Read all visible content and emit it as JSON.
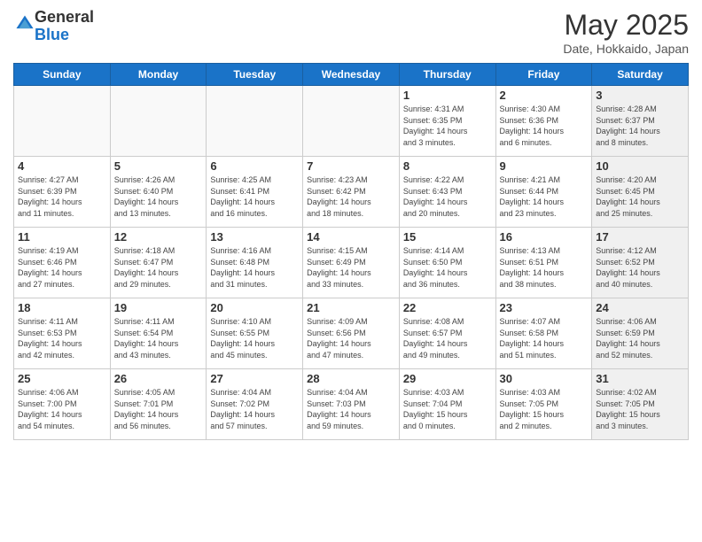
{
  "logo": {
    "general": "General",
    "blue": "Blue"
  },
  "title": "May 2025",
  "subtitle": "Date, Hokkaido, Japan",
  "days_of_week": [
    "Sunday",
    "Monday",
    "Tuesday",
    "Wednesday",
    "Thursday",
    "Friday",
    "Saturday"
  ],
  "weeks": [
    [
      {
        "day": "",
        "info": "",
        "empty": true
      },
      {
        "day": "",
        "info": "",
        "empty": true
      },
      {
        "day": "",
        "info": "",
        "empty": true
      },
      {
        "day": "",
        "info": "",
        "empty": true
      },
      {
        "day": "1",
        "info": "Sunrise: 4:31 AM\nSunset: 6:35 PM\nDaylight: 14 hours\nand 3 minutes."
      },
      {
        "day": "2",
        "info": "Sunrise: 4:30 AM\nSunset: 6:36 PM\nDaylight: 14 hours\nand 6 minutes."
      },
      {
        "day": "3",
        "info": "Sunrise: 4:28 AM\nSunset: 6:37 PM\nDaylight: 14 hours\nand 8 minutes.",
        "shaded": true
      }
    ],
    [
      {
        "day": "4",
        "info": "Sunrise: 4:27 AM\nSunset: 6:39 PM\nDaylight: 14 hours\nand 11 minutes."
      },
      {
        "day": "5",
        "info": "Sunrise: 4:26 AM\nSunset: 6:40 PM\nDaylight: 14 hours\nand 13 minutes."
      },
      {
        "day": "6",
        "info": "Sunrise: 4:25 AM\nSunset: 6:41 PM\nDaylight: 14 hours\nand 16 minutes."
      },
      {
        "day": "7",
        "info": "Sunrise: 4:23 AM\nSunset: 6:42 PM\nDaylight: 14 hours\nand 18 minutes."
      },
      {
        "day": "8",
        "info": "Sunrise: 4:22 AM\nSunset: 6:43 PM\nDaylight: 14 hours\nand 20 minutes."
      },
      {
        "day": "9",
        "info": "Sunrise: 4:21 AM\nSunset: 6:44 PM\nDaylight: 14 hours\nand 23 minutes."
      },
      {
        "day": "10",
        "info": "Sunrise: 4:20 AM\nSunset: 6:45 PM\nDaylight: 14 hours\nand 25 minutes.",
        "shaded": true
      }
    ],
    [
      {
        "day": "11",
        "info": "Sunrise: 4:19 AM\nSunset: 6:46 PM\nDaylight: 14 hours\nand 27 minutes."
      },
      {
        "day": "12",
        "info": "Sunrise: 4:18 AM\nSunset: 6:47 PM\nDaylight: 14 hours\nand 29 minutes."
      },
      {
        "day": "13",
        "info": "Sunrise: 4:16 AM\nSunset: 6:48 PM\nDaylight: 14 hours\nand 31 minutes."
      },
      {
        "day": "14",
        "info": "Sunrise: 4:15 AM\nSunset: 6:49 PM\nDaylight: 14 hours\nand 33 minutes."
      },
      {
        "day": "15",
        "info": "Sunrise: 4:14 AM\nSunset: 6:50 PM\nDaylight: 14 hours\nand 36 minutes."
      },
      {
        "day": "16",
        "info": "Sunrise: 4:13 AM\nSunset: 6:51 PM\nDaylight: 14 hours\nand 38 minutes."
      },
      {
        "day": "17",
        "info": "Sunrise: 4:12 AM\nSunset: 6:52 PM\nDaylight: 14 hours\nand 40 minutes.",
        "shaded": true
      }
    ],
    [
      {
        "day": "18",
        "info": "Sunrise: 4:11 AM\nSunset: 6:53 PM\nDaylight: 14 hours\nand 42 minutes."
      },
      {
        "day": "19",
        "info": "Sunrise: 4:11 AM\nSunset: 6:54 PM\nDaylight: 14 hours\nand 43 minutes."
      },
      {
        "day": "20",
        "info": "Sunrise: 4:10 AM\nSunset: 6:55 PM\nDaylight: 14 hours\nand 45 minutes."
      },
      {
        "day": "21",
        "info": "Sunrise: 4:09 AM\nSunset: 6:56 PM\nDaylight: 14 hours\nand 47 minutes."
      },
      {
        "day": "22",
        "info": "Sunrise: 4:08 AM\nSunset: 6:57 PM\nDaylight: 14 hours\nand 49 minutes."
      },
      {
        "day": "23",
        "info": "Sunrise: 4:07 AM\nSunset: 6:58 PM\nDaylight: 14 hours\nand 51 minutes."
      },
      {
        "day": "24",
        "info": "Sunrise: 4:06 AM\nSunset: 6:59 PM\nDaylight: 14 hours\nand 52 minutes.",
        "shaded": true
      }
    ],
    [
      {
        "day": "25",
        "info": "Sunrise: 4:06 AM\nSunset: 7:00 PM\nDaylight: 14 hours\nand 54 minutes."
      },
      {
        "day": "26",
        "info": "Sunrise: 4:05 AM\nSunset: 7:01 PM\nDaylight: 14 hours\nand 56 minutes."
      },
      {
        "day": "27",
        "info": "Sunrise: 4:04 AM\nSunset: 7:02 PM\nDaylight: 14 hours\nand 57 minutes."
      },
      {
        "day": "28",
        "info": "Sunrise: 4:04 AM\nSunset: 7:03 PM\nDaylight: 14 hours\nand 59 minutes."
      },
      {
        "day": "29",
        "info": "Sunrise: 4:03 AM\nSunset: 7:04 PM\nDaylight: 15 hours\nand 0 minutes."
      },
      {
        "day": "30",
        "info": "Sunrise: 4:03 AM\nSunset: 7:05 PM\nDaylight: 15 hours\nand 2 minutes."
      },
      {
        "day": "31",
        "info": "Sunrise: 4:02 AM\nSunset: 7:05 PM\nDaylight: 15 hours\nand 3 minutes.",
        "shaded": true
      }
    ]
  ]
}
